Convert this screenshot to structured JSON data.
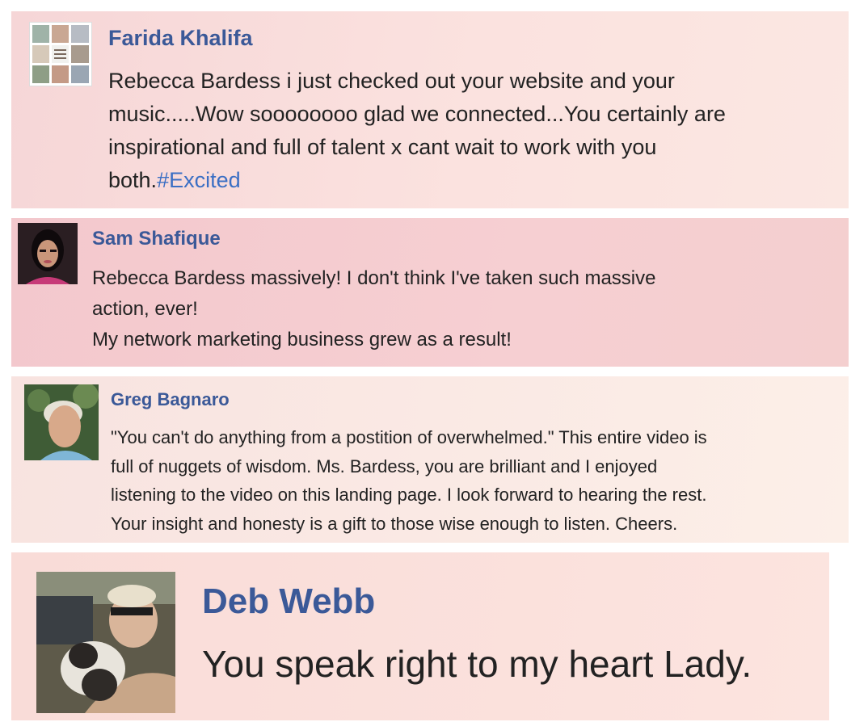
{
  "comments": [
    {
      "name": "Farida Khalifa",
      "lines": [
        "Rebecca Bardess i just checked out your website and your",
        "music.....Wow soooooooo glad we connected...You certainly are",
        "inspirational and full of talent x cant wait to work with you",
        "both."
      ],
      "hashtag": "#Excited"
    },
    {
      "name": "Sam Shafique",
      "lines": [
        "Rebecca Bardess massively! I don't think I've taken such massive",
        "action, ever!",
        "My network marketing business grew as a result!"
      ]
    },
    {
      "name": "Greg Bagnaro",
      "lines": [
        "\"You can't do anything from a postition of overwhelmed.\" This entire video is",
        "full of nuggets of wisdom. Ms. Bardess, you are brilliant and I enjoyed",
        "listening to the video on this landing page. I look forward to hearing the rest.",
        "Your insight and honesty is a gift to those wise enough to listen. Cheers."
      ]
    },
    {
      "name": "Deb Webb",
      "lines": [
        "You speak right to my heart Lady."
      ]
    }
  ],
  "colors": {
    "name": "#3b5998",
    "hashtag": "#3b6fc4",
    "text": "#222222"
  }
}
